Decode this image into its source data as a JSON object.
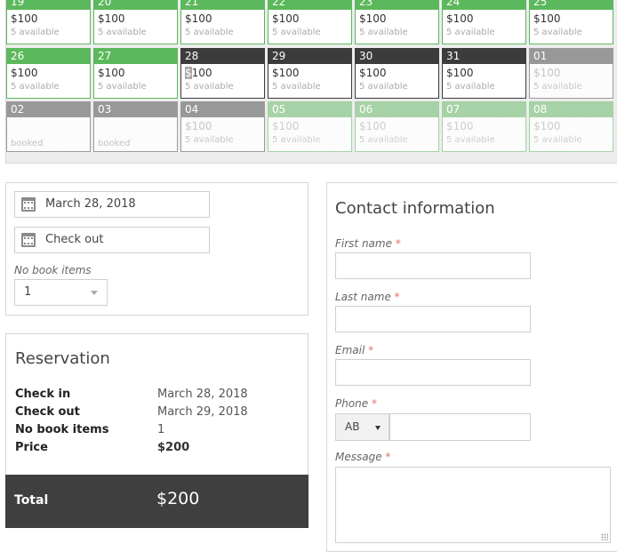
{
  "calendar": {
    "rows": [
      [
        {
          "date": "19",
          "price": "$100",
          "avail": "5 available",
          "state": "green"
        },
        {
          "date": "20",
          "price": "$100",
          "avail": "5 available",
          "state": "green"
        },
        {
          "date": "21",
          "price": "$100",
          "avail": "5 available",
          "state": "green"
        },
        {
          "date": "22",
          "price": "$100",
          "avail": "5 available",
          "state": "green"
        },
        {
          "date": "23",
          "price": "$100",
          "avail": "5 available",
          "state": "green"
        },
        {
          "date": "24",
          "price": "$100",
          "avail": "5 available",
          "state": "green"
        },
        {
          "date": "25",
          "price": "$100",
          "avail": "5 available",
          "state": "green"
        }
      ],
      [
        {
          "date": "26",
          "price": "$100",
          "avail": "5 available",
          "state": "green"
        },
        {
          "date": "27",
          "price": "$100",
          "avail": "5 available",
          "state": "green"
        },
        {
          "date": "28",
          "price": "$100",
          "avail": "5 available",
          "state": "dark",
          "highlight_first": true
        },
        {
          "date": "29",
          "price": "$100",
          "avail": "5 available",
          "state": "dark"
        },
        {
          "date": "30",
          "price": "$100",
          "avail": "5 available",
          "state": "dark"
        },
        {
          "date": "31",
          "price": "$100",
          "avail": "5 available",
          "state": "dark"
        },
        {
          "date": "01",
          "price": "$100",
          "avail": "5 available",
          "state": "muted"
        }
      ],
      [
        {
          "date": "02",
          "price": "",
          "avail": "booked",
          "state": "muted-booked"
        },
        {
          "date": "03",
          "price": "",
          "avail": "booked",
          "state": "muted-booked"
        },
        {
          "date": "04",
          "price": "$100",
          "avail": "5 available",
          "state": "muted"
        },
        {
          "date": "05",
          "price": "$100",
          "avail": "5 available",
          "state": "light"
        },
        {
          "date": "06",
          "price": "$100",
          "avail": "5 available",
          "state": "light"
        },
        {
          "date": "07",
          "price": "$100",
          "avail": "5 available",
          "state": "light"
        },
        {
          "date": "08",
          "price": "$100",
          "avail": "5 available",
          "state": "light"
        }
      ]
    ]
  },
  "search": {
    "checkin_value": "March 28, 2018",
    "checkout_placeholder": "Check out",
    "items_label": "No book items",
    "items_value": "1"
  },
  "reservation": {
    "title": "Reservation",
    "rows": [
      {
        "label": "Check in",
        "value": "March 28, 2018"
      },
      {
        "label": "Check out",
        "value": "March 29, 2018"
      },
      {
        "label": "No book items",
        "value": "1"
      },
      {
        "label": "Price",
        "value": "$200"
      }
    ],
    "total_label": "Total",
    "total_value": "$200"
  },
  "contact": {
    "title": "Contact information",
    "first_name_label": "First name",
    "last_name_label": "Last name",
    "email_label": "Email",
    "phone_label": "Phone",
    "phone_code": "AB",
    "message_label": "Message",
    "required_mark": "*"
  },
  "colors": {
    "available": "#5cb85c",
    "selected": "#3c3c3c",
    "unavailable": "#989898",
    "future": "#a7d2a7"
  }
}
